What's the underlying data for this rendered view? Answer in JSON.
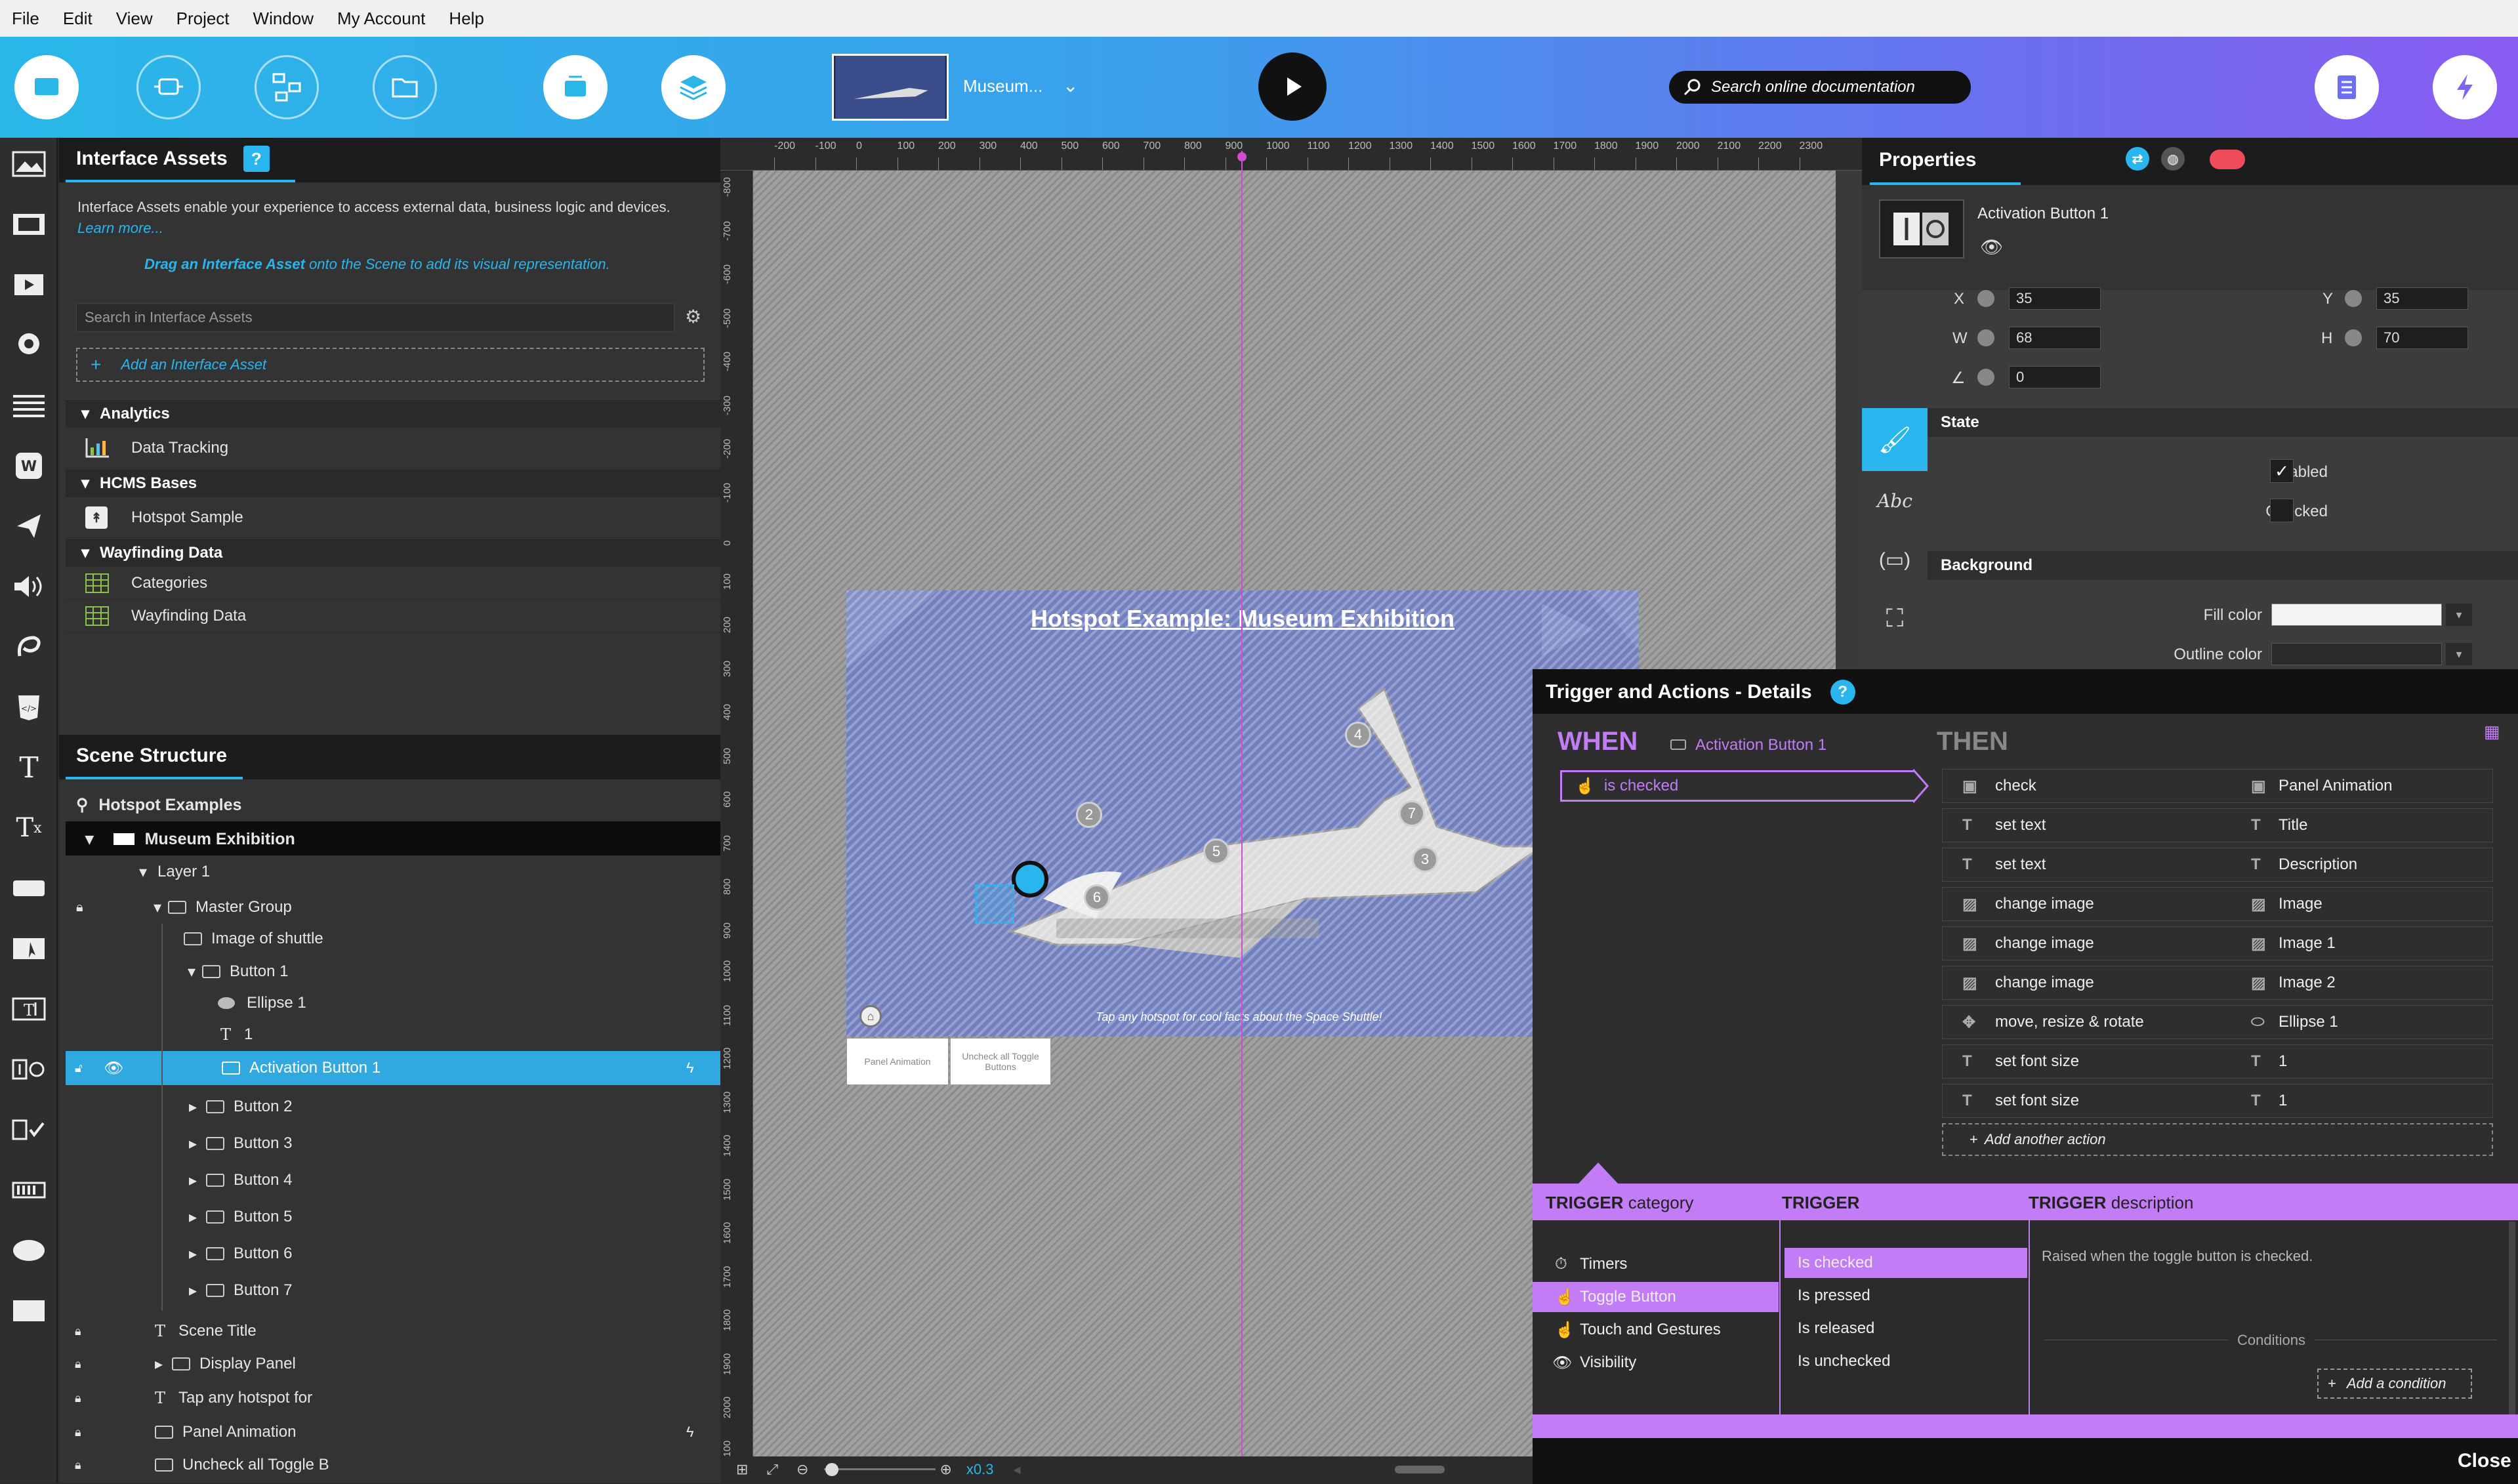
{
  "menu": [
    "File",
    "Edit",
    "View",
    "Project",
    "Window",
    "My Account",
    "Help"
  ],
  "toolbar": {
    "project_name": "Museum...",
    "search_placeholder": "Search online documentation"
  },
  "interface_assets": {
    "title": "Interface Assets",
    "help": "?",
    "description": "Interface Assets enable your experience to access external data, business logic and devices.",
    "learn_more": "Learn more...",
    "drag_hint_em": "Drag an Interface Asset",
    "drag_hint_rest": " onto the Scene to add its visual representation.",
    "search_placeholder": "Search in Interface Assets",
    "add_label": "Add an Interface Asset",
    "groups": [
      {
        "name": "Analytics",
        "items": [
          "Data Tracking"
        ]
      },
      {
        "name": "HCMS Bases",
        "items": [
          "Hotspot Sample"
        ]
      },
      {
        "name": "Wayfinding Data",
        "items": [
          "Categories",
          "Wayfinding Data"
        ]
      }
    ]
  },
  "scene_structure": {
    "title": "Scene Structure",
    "rows": [
      {
        "label": "Hotspot Examples"
      },
      {
        "label": "Museum Exhibition"
      },
      {
        "label": "Layer 1"
      },
      {
        "label": "Master Group"
      },
      {
        "label": "Image of shuttle"
      },
      {
        "label": "Button 1"
      },
      {
        "label": "Ellipse 1"
      },
      {
        "label": "1"
      },
      {
        "label": "Activation Button 1"
      },
      {
        "label": "Button 2"
      },
      {
        "label": "Button 3"
      },
      {
        "label": "Button 4"
      },
      {
        "label": "Button 5"
      },
      {
        "label": "Button 6"
      },
      {
        "label": "Button 7"
      },
      {
        "label": "Scene Title"
      },
      {
        "label": "Display Panel"
      },
      {
        "label": "Tap any hotspot for"
      },
      {
        "label": "Panel Animation"
      },
      {
        "label": "Uncheck all Toggle B"
      }
    ]
  },
  "ruler": {
    "x_ticks": [
      "-200",
      "-100",
      "0",
      "100",
      "200",
      "300",
      "400",
      "500",
      "600",
      "700",
      "800",
      "900",
      "1000",
      "1100",
      "1200",
      "1300",
      "1400",
      "1500",
      "1600",
      "1700",
      "1800",
      "1900",
      "2000",
      "2100",
      "2200",
      "2300"
    ],
    "y_ticks": [
      "-800",
      "-700",
      "-600",
      "-500",
      "-400",
      "-300",
      "-200",
      "-100",
      "0",
      "100",
      "200",
      "300",
      "400",
      "500",
      "600",
      "700",
      "800",
      "900",
      "1000",
      "1100",
      "1200",
      "1300",
      "1400",
      "1500",
      "1600",
      "1700",
      "1800",
      "1900",
      "2000",
      "2100"
    ]
  },
  "canvas": {
    "scene_title": "Hotspot Example: Museum Exhibition",
    "caption": "Tap any hotspot for cool facts about the Space Shuttle!",
    "hotspots": [
      "2",
      "4",
      "7",
      "5",
      "3",
      "6"
    ],
    "off_stage": [
      "Panel Animation",
      "Uncheck all Toggle Buttons"
    ],
    "zoom": "x0.3"
  },
  "properties": {
    "title": "Properties",
    "object_name": "Activation Button 1",
    "x_label": "X",
    "x": "35",
    "y_label": "Y",
    "y": "35",
    "w_label": "W",
    "w": "68",
    "h_label": "H",
    "h": "70",
    "angle": "0",
    "state_header": "State",
    "enabled_label": "Enabled",
    "checked_label": "Checked",
    "background_header": "Background",
    "fill_color_label": "Fill color",
    "outline_color_label": "Outline color"
  },
  "trigger": {
    "title": "Trigger and Actions - Details",
    "help": "?",
    "when": "WHEN",
    "when_object": "Activation Button 1",
    "condition": "is checked",
    "then": "THEN",
    "actions": [
      {
        "verb": "check",
        "target": "Panel Animation"
      },
      {
        "verb": "set text",
        "target": "Title"
      },
      {
        "verb": "set text",
        "target": "Description"
      },
      {
        "verb": "change image",
        "target": "Image"
      },
      {
        "verb": "change image",
        "target": "Image 1"
      },
      {
        "verb": "change image",
        "target": "Image 2"
      },
      {
        "verb": "move, resize & rotate",
        "target": "Ellipse 1"
      },
      {
        "verb": "set font size",
        "target": "1"
      },
      {
        "verb": "set font size",
        "target": "1"
      }
    ],
    "add_action": "Add another action",
    "category_header_strong": "TRIGGER",
    "category_header_rest": "category",
    "trigger_header": "TRIGGER",
    "desc_header_strong": "TRIGGER",
    "desc_header_rest": "description",
    "categories": [
      "Timers",
      "Toggle Button",
      "Touch and Gestures",
      "Visibility"
    ],
    "triggers": [
      "Is checked",
      "Is pressed",
      "Is released",
      "Is unchecked"
    ],
    "description": "Raised when the toggle button is checked.",
    "conditions_label": "Conditions",
    "add_condition": "Add a condition",
    "close": "Close"
  },
  "colors": {
    "accent_blue": "#29b6ee",
    "accent_purple": "#c27cf5",
    "selection_blue": "#2fa9e0"
  }
}
